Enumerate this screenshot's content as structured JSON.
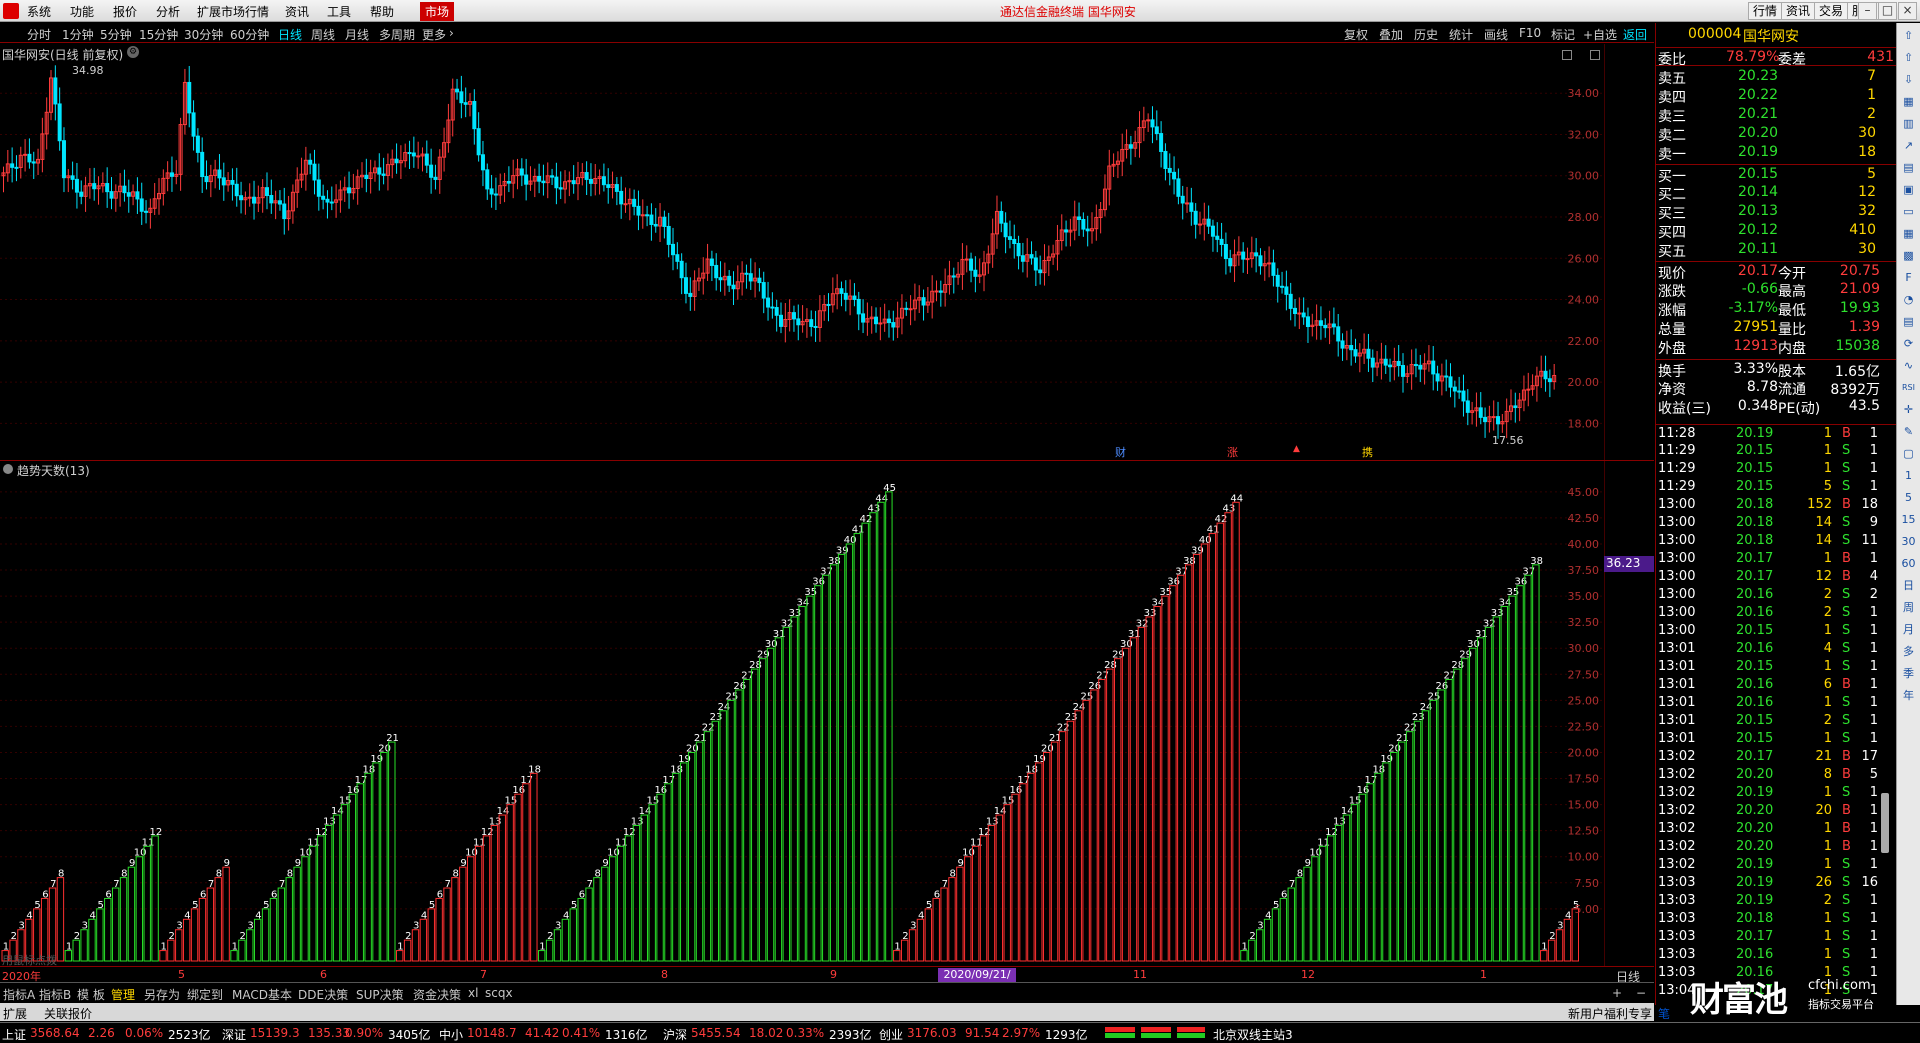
{
  "menubar": {
    "items": [
      "系统",
      "功能",
      "报价",
      "分析",
      "扩展市场行情",
      "资讯",
      "工具",
      "帮助"
    ],
    "market": "市场",
    "center_title": "通达信金融终端  国华网安",
    "right_buttons": [
      "行情",
      "资讯",
      "交易",
      "服务"
    ]
  },
  "periods": [
    "分时",
    "1分钟",
    "5分钟",
    "15分钟",
    "30分钟",
    "60分钟",
    "日线",
    "周线",
    "月线",
    "多周期",
    "更多"
  ],
  "active_period": "日线",
  "toolbar": [
    "复权",
    "叠加",
    "历史",
    "统计",
    "画线",
    "F10",
    "标记",
    "+自选",
    "返回"
  ],
  "main_chart": {
    "title": "国华网安(日线 前复权)",
    "high_label": "34.98",
    "low_label": "17.56",
    "y_ticks": [
      "34.00",
      "32.00",
      "30.00",
      "28.00",
      "26.00",
      "24.00",
      "22.00",
      "20.00",
      "18.00"
    ],
    "y_min": 17,
    "y_max": 35.9,
    "events": [
      "财",
      "涨",
      "▲",
      "携"
    ]
  },
  "chart_data": {
    "type": "bar",
    "title": "趋势天数(13)",
    "ylim": [
      0,
      47
    ],
    "y_ticks": [
      "45.00",
      "42.50",
      "40.00",
      "37.50",
      "35.00",
      "32.50",
      "30.00",
      "27.50",
      "25.00",
      "22.50",
      "20.00",
      "17.50",
      "15.00",
      "12.50",
      "10.00",
      "7.50",
      "5.00"
    ],
    "current_value": "36.23",
    "segments": [
      {
        "color": "red",
        "end": 8
      },
      {
        "color": "green",
        "end": 12
      },
      {
        "color": "red",
        "end": 9
      },
      {
        "color": "green",
        "end": 21
      },
      {
        "color": "red",
        "end": 18
      },
      {
        "color": "green",
        "end": 45
      },
      {
        "color": "red",
        "end": 44
      },
      {
        "color": "green",
        "end": 38
      },
      {
        "color": "red",
        "end": 5
      }
    ]
  },
  "xaxis": {
    "year_label": "2020年",
    "months": [
      "5",
      "6",
      "7",
      "8",
      "9",
      "11",
      "12",
      "1"
    ],
    "date_box": "2020/09/21/—",
    "period": "日线"
  },
  "quote": {
    "code": "000004",
    "name": "国华网安",
    "weibi_label": "委比",
    "weibi": "78.79%",
    "weicha_label": "委差",
    "weicha": "431",
    "asks": [
      {
        "label": "卖五",
        "price": "20.23",
        "vol": "7"
      },
      {
        "label": "卖四",
        "price": "20.22",
        "vol": "1"
      },
      {
        "label": "卖三",
        "price": "20.21",
        "vol": "2"
      },
      {
        "label": "卖二",
        "price": "20.20",
        "vol": "30"
      },
      {
        "label": "卖一",
        "price": "20.19",
        "vol": "18"
      }
    ],
    "bids": [
      {
        "label": "买一",
        "price": "20.15",
        "vol": "5"
      },
      {
        "label": "买二",
        "price": "20.14",
        "vol": "12"
      },
      {
        "label": "买三",
        "price": "20.13",
        "vol": "32"
      },
      {
        "label": "买四",
        "price": "20.12",
        "vol": "410"
      },
      {
        "label": "买五",
        "price": "20.11",
        "vol": "30"
      }
    ],
    "stats": [
      {
        "l1": "现价",
        "v1": "20.17",
        "l2": "今开",
        "v2": "20.75",
        "c1": "red",
        "c2": "red"
      },
      {
        "l1": "涨跌",
        "v1": "-0.66",
        "l2": "最高",
        "v2": "21.09",
        "c1": "grn",
        "c2": "red"
      },
      {
        "l1": "涨幅",
        "v1": "-3.17%",
        "l2": "最低",
        "v2": "19.93",
        "c1": "grn",
        "c2": "grn"
      },
      {
        "l1": "总量",
        "v1": "27951",
        "l2": "量比",
        "v2": "1.39",
        "c1": "yel",
        "c2": "red"
      },
      {
        "l1": "外盘",
        "v1": "12913",
        "l2": "内盘",
        "v2": "15038",
        "c1": "red",
        "c2": "grn"
      }
    ],
    "stats2": [
      {
        "l1": "换手",
        "v1": "3.33%",
        "l2": "股本",
        "v2": "1.65亿"
      },
      {
        "l1": "净资",
        "v1": "8.78",
        "l2": "流通",
        "v2": "8392万"
      },
      {
        "l1": "收益(三)",
        "v1": "0.348",
        "l2": "PE(动)",
        "v2": "43.5"
      }
    ],
    "ticks": [
      [
        "11:28",
        "20.19",
        "1",
        "B",
        "1"
      ],
      [
        "11:29",
        "20.15",
        "1",
        "S",
        "1"
      ],
      [
        "11:29",
        "20.15",
        "1",
        "S",
        "1"
      ],
      [
        "11:29",
        "20.15",
        "5",
        "S",
        "1"
      ],
      [
        "13:00",
        "20.18",
        "152",
        "B",
        "18"
      ],
      [
        "13:00",
        "20.18",
        "14",
        "S",
        "9"
      ],
      [
        "13:00",
        "20.18",
        "14",
        "S",
        "11"
      ],
      [
        "13:00",
        "20.17",
        "1",
        "B",
        "1"
      ],
      [
        "13:00",
        "20.17",
        "12",
        "B",
        "4"
      ],
      [
        "13:00",
        "20.16",
        "2",
        "S",
        "2"
      ],
      [
        "13:00",
        "20.16",
        "2",
        "S",
        "1"
      ],
      [
        "13:00",
        "20.15",
        "1",
        "S",
        "1"
      ],
      [
        "13:01",
        "20.16",
        "4",
        "S",
        "1"
      ],
      [
        "13:01",
        "20.15",
        "1",
        "S",
        "1"
      ],
      [
        "13:01",
        "20.16",
        "6",
        "B",
        "1"
      ],
      [
        "13:01",
        "20.16",
        "1",
        "S",
        "1"
      ],
      [
        "13:01",
        "20.15",
        "2",
        "S",
        "1"
      ],
      [
        "13:01",
        "20.15",
        "1",
        "S",
        "1"
      ],
      [
        "13:02",
        "20.17",
        "21",
        "B",
        "17"
      ],
      [
        "13:02",
        "20.20",
        "8",
        "B",
        "5"
      ],
      [
        "13:02",
        "20.19",
        "1",
        "S",
        "1"
      ],
      [
        "13:02",
        "20.20",
        "20",
        "B",
        "1"
      ],
      [
        "13:02",
        "20.20",
        "1",
        "B",
        "1"
      ],
      [
        "13:02",
        "20.20",
        "1",
        "B",
        "1"
      ],
      [
        "13:02",
        "20.19",
        "1",
        "S",
        "1"
      ],
      [
        "13:03",
        "20.19",
        "26",
        "S",
        "16"
      ],
      [
        "13:03",
        "20.19",
        "2",
        "S",
        "1"
      ],
      [
        "13:03",
        "20.18",
        "1",
        "S",
        "1"
      ],
      [
        "13:03",
        "20.17",
        "1",
        "S",
        "1"
      ],
      [
        "13:03",
        "20.16",
        "1",
        "S",
        "1"
      ],
      [
        "13:03",
        "20.16",
        "1",
        "S",
        "1"
      ],
      [
        "13:04",
        "20.17",
        "1",
        "S",
        "1"
      ]
    ]
  },
  "sidebar_icons": [
    "up",
    "up",
    "dn",
    "grid",
    "chart",
    "line",
    "book",
    "doc",
    "tv",
    "cal",
    "calc",
    "F",
    "pie",
    "news",
    "sync",
    "wave",
    "RSI",
    "cross",
    "pen",
    "note",
    "1",
    "5",
    "15",
    "30",
    "60",
    "日",
    "周",
    "月",
    "多",
    "季",
    "年"
  ],
  "tabs": [
    "指标A",
    "指标B",
    "模 板",
    "管理",
    "另存为",
    "绑定到",
    "MACD基本",
    "DDE决策",
    "SUP决策",
    "资金决策",
    "xl",
    "scqx"
  ],
  "active_tab": "管理",
  "kz_items": [
    "扩展",
    "关联报价"
  ],
  "kz_right": [
    "新用户福利专享",
    "笔"
  ],
  "watermark": [
    "财富池",
    "cfchi.com",
    "指标交易平台"
  ],
  "ind_hint": "用鼠标点拨",
  "status": {
    "items": [
      {
        "name": "上证",
        "price": "3568.64",
        "chg": "2.26",
        "pct": "0.06%",
        "amt": "2523亿",
        "c": "red"
      },
      {
        "name": "深证",
        "price": "15139.3",
        "chg": "135.33",
        "pct": "0.90%",
        "amt": "3405亿",
        "c": "red"
      },
      {
        "name": "中小",
        "price": "10148.7",
        "chg": "41.42",
        "pct": "0.41%",
        "amt": "1316亿",
        "c": "red"
      },
      {
        "name": "沪深",
        "price": "5455.54",
        "chg": "18.02",
        "pct": "0.33%",
        "amt": "2393亿",
        "c": "red"
      },
      {
        "name": "创业",
        "price": "3176.03",
        "chg": "91.54",
        "pct": "2.97%",
        "amt": "1293亿",
        "c": "red"
      }
    ],
    "server": "北京双线主站3"
  }
}
